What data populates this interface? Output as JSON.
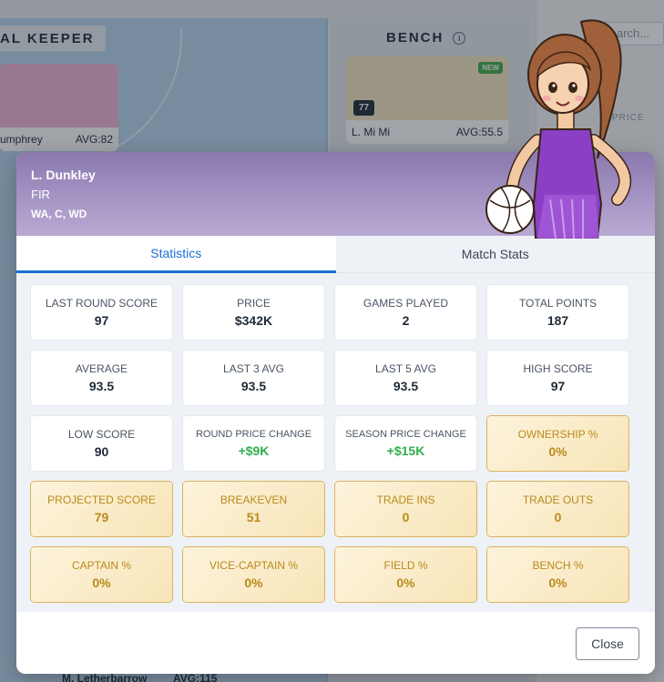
{
  "background": {
    "goal_keeper_header": "AL KEEPER",
    "bench_header": "BENCH",
    "search_placeholder": "Search...",
    "side_price_label": "PRICE",
    "gk_card": {
      "name": "umphrey",
      "avg": "AVG:82"
    },
    "bench_card": {
      "name": "L. Mi Mi",
      "avg": "AVG:55.5",
      "score": "77",
      "badge": "NEW"
    },
    "bottom_left_name": "M. Letherbarrow",
    "bottom_left_avg": "AVG:115"
  },
  "player": {
    "name": "L. Dunkley",
    "team": "FIR",
    "positions": "WA, C, WD"
  },
  "tabs": [
    {
      "label": "Statistics",
      "active": true
    },
    {
      "label": "Match Stats",
      "active": false
    }
  ],
  "stats": [
    {
      "label": "LAST ROUND SCORE",
      "value": "97",
      "style": "plain"
    },
    {
      "label": "PRICE",
      "value": "$342K",
      "style": "plain"
    },
    {
      "label": "GAMES PLAYED",
      "value": "2",
      "style": "plain"
    },
    {
      "label": "TOTAL POINTS",
      "value": "187",
      "style": "plain"
    },
    {
      "label": "AVERAGE",
      "value": "93.5",
      "style": "plain"
    },
    {
      "label": "LAST 3 AVG",
      "value": "93.5",
      "style": "plain"
    },
    {
      "label": "LAST 5 AVG",
      "value": "93.5",
      "style": "plain"
    },
    {
      "label": "HIGH SCORE",
      "value": "97",
      "style": "plain"
    },
    {
      "label": "LOW SCORE",
      "value": "90",
      "style": "plain"
    },
    {
      "label": "ROUND PRICE CHANGE",
      "value": "+$9K",
      "style": "plain-positive"
    },
    {
      "label": "SEASON PRICE CHANGE",
      "value": "+$15K",
      "style": "plain-positive"
    },
    {
      "label": "OWNERSHIP %",
      "value": "0%",
      "style": "gold"
    },
    {
      "label": "PROJECTED SCORE",
      "value": "79",
      "style": "gold"
    },
    {
      "label": "BREAKEVEN",
      "value": "51",
      "style": "gold"
    },
    {
      "label": "TRADE INS",
      "value": "0",
      "style": "gold"
    },
    {
      "label": "TRADE OUTS",
      "value": "0",
      "style": "gold"
    },
    {
      "label": "CAPTAIN %",
      "value": "0%",
      "style": "gold"
    },
    {
      "label": "VICE-CAPTAIN %",
      "value": "0%",
      "style": "gold"
    },
    {
      "label": "FIELD %",
      "value": "0%",
      "style": "gold"
    },
    {
      "label": "BENCH %",
      "value": "0%",
      "style": "gold"
    }
  ],
  "footer": {
    "close_label": "Close"
  },
  "colors": {
    "accent": "#1a6fd6",
    "header_purple": "#8a78ad",
    "gold_text": "#b88a1c",
    "positive": "#2fae4d"
  }
}
